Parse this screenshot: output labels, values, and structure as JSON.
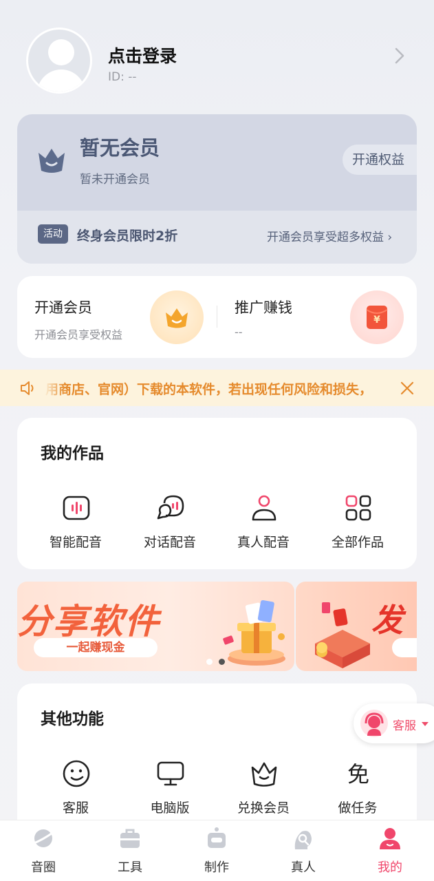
{
  "profile": {
    "login_text": "点击登录",
    "user_id": "ID: --"
  },
  "vip": {
    "title": "暂无会员",
    "subtitle": "暂未开通会员",
    "open_button": "开通权益",
    "activity_badge": "活动",
    "activity_text": "终身会员限时2折",
    "activity_link": "开通会员享受超多权益 ›"
  },
  "promo": {
    "left_title": "开通会员",
    "left_sub": "开通会员享受权益",
    "right_title": "推广赚钱",
    "right_sub": "--"
  },
  "notice": {
    "text": "用商店、官网）下载的本软件，若出现任何风险和损失，"
  },
  "works": {
    "title": "我的作品",
    "items": [
      {
        "label": "智能配音",
        "icon": "voice-wave-icon"
      },
      {
        "label": "对话配音",
        "icon": "chat-bubbles-icon"
      },
      {
        "label": "真人配音",
        "icon": "person-icon"
      },
      {
        "label": "全部作品",
        "icon": "grid-apps-icon"
      }
    ]
  },
  "banner": {
    "title": "分享软件",
    "pill": "一起赚现金",
    "next_title": "发",
    "active_slide": 2,
    "slide_count": 2
  },
  "other": {
    "title": "其他功能",
    "items": [
      {
        "label": "客服",
        "icon": "smile-face-icon"
      },
      {
        "label": "电脑版",
        "icon": "monitor-icon"
      },
      {
        "label": "兑换会员",
        "icon": "crown-outline-icon"
      },
      {
        "label": "做任务",
        "icon": "free-task-icon"
      }
    ]
  },
  "float_service": {
    "label": "客服"
  },
  "tabbar": {
    "items": [
      {
        "label": "音圈",
        "icon": "planet-icon",
        "active": false
      },
      {
        "label": "工具",
        "icon": "briefcase-icon",
        "active": false
      },
      {
        "label": "制作",
        "icon": "robot-icon",
        "active": false
      },
      {
        "label": "真人",
        "icon": "search-person-icon",
        "active": false
      },
      {
        "label": "我的",
        "icon": "profile-icon",
        "active": true
      }
    ]
  },
  "colors": {
    "accent": "#f0466b",
    "vip_text": "#4b5875",
    "notice_text": "#e58a2c",
    "banner_text": "#f2623c"
  }
}
